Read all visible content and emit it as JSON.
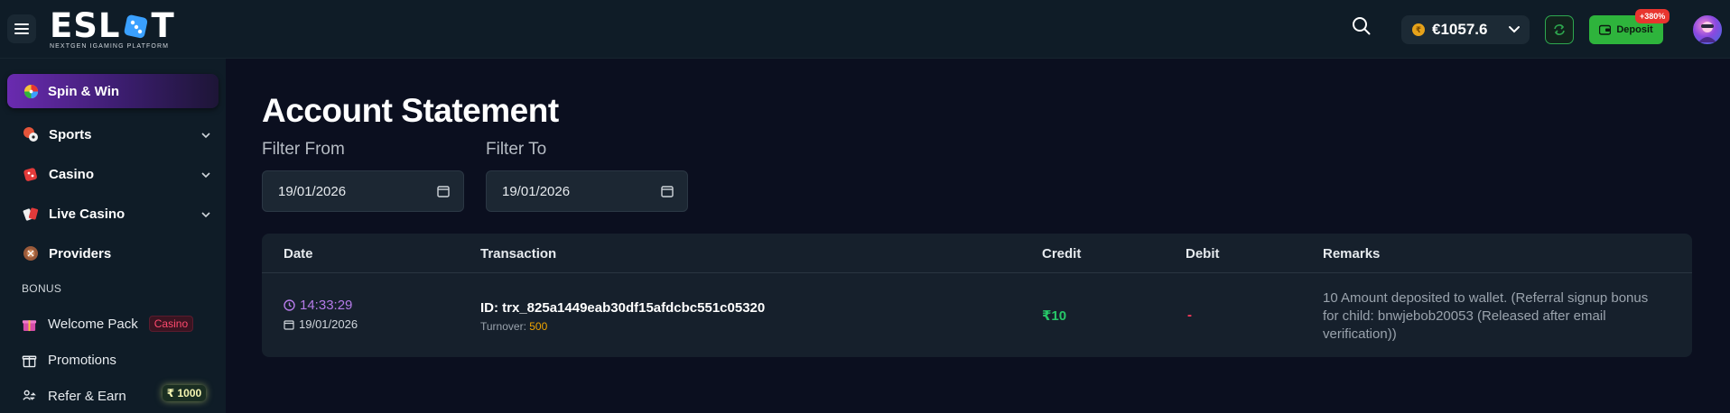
{
  "header": {
    "logo_text": "ESLOT",
    "logo_subtitle": "NEXTGEN IGAMING PLATFORM",
    "balance": "€1057.6",
    "coin_symbol": "₹",
    "deposit_label": "Deposit",
    "deposit_badge": "+380%"
  },
  "sidebar": {
    "spin_win": "Spin & Win",
    "items": [
      {
        "label": "Sports"
      },
      {
        "label": "Casino"
      },
      {
        "label": "Live Casino"
      },
      {
        "label": "Providers"
      }
    ],
    "bonus_section": "BONUS",
    "welcome_pack": "Welcome Pack",
    "welcome_tag": "Casino",
    "promotions": "Promotions",
    "refer_earn": "Refer & Earn",
    "refer_reward": "₹ 1000"
  },
  "main": {
    "title": "Account Statement",
    "filter_from_label": "Filter From",
    "filter_to_label": "Filter To",
    "filter_from_value": "19/01/2026",
    "filter_to_value": "19/01/2026"
  },
  "table": {
    "headers": [
      "Date",
      "Transaction",
      "Credit",
      "Debit",
      "Remarks"
    ],
    "rows": [
      {
        "time": "14:33:29",
        "date": "19/01/2026",
        "transaction_id": "ID: trx_825a1449eab30df15afdcbc551c05320",
        "turnover_label": "Turnover:",
        "turnover_value": "500",
        "credit": "₹10",
        "debit": "-",
        "remarks": "10 Amount deposited to wallet. (Referral signup bonus for child: bnwjebob20053 (Released after email verification))"
      }
    ]
  },
  "colors": {
    "accent_green": "#27c768",
    "accent_purple": "#b57be8",
    "deposit_green": "#2eb43c",
    "badge_red": "#e8352f",
    "turnover_orange": "#f0a500"
  }
}
